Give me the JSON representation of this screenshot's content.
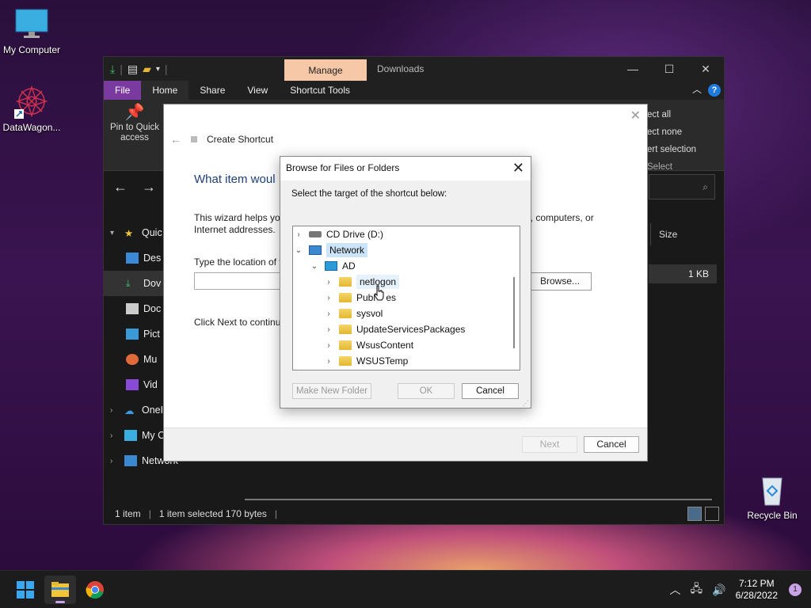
{
  "desktop": {
    "icons": [
      {
        "label": "My Computer"
      },
      {
        "label": "DataWagon..."
      },
      {
        "label": "Recycle Bin"
      }
    ]
  },
  "explorer": {
    "context_tab": "Manage",
    "title": "Downloads",
    "ribbon_tabs": [
      "File",
      "Home",
      "Share",
      "View",
      "Shortcut Tools"
    ],
    "pin_label": "Pin to Quick access",
    "selection_items": [
      "ect all",
      "ect none",
      "ert selection"
    ],
    "selection_group": "Select",
    "column_size": "Size",
    "file_size": "1 KB",
    "sidebar": [
      {
        "label": "Quic",
        "level": 0,
        "expanded": true
      },
      {
        "label": "Des",
        "level": 1
      },
      {
        "label": "Dov",
        "level": 1,
        "selected": true
      },
      {
        "label": "Doc",
        "level": 1
      },
      {
        "label": "Pict",
        "level": 1
      },
      {
        "label": "Mu",
        "level": 1
      },
      {
        "label": "Vid",
        "level": 1
      },
      {
        "label": "OneI",
        "level": 0
      },
      {
        "label": "My C",
        "level": 0
      },
      {
        "label": "Network",
        "level": 0
      }
    ],
    "status": {
      "items": "1 item",
      "selected": "1 item selected  170 bytes"
    }
  },
  "wizard": {
    "title": "Create Shortcut",
    "question": "What item woul",
    "desc_left": "This wizard helps you",
    "desc_left2": "Internet addresses.",
    "desc_right": "ers, computers, or",
    "location_label": "Type the location of t",
    "browse": "Browse...",
    "next_hint": "Click Next to continu",
    "next": "Next",
    "cancel": "Cancel"
  },
  "browse_dialog": {
    "title": "Browse for Files or Folders",
    "instruction": "Select the target of the shortcut below:",
    "tree": [
      {
        "label": "CD Drive (D:)",
        "icon": "drive-icon"
      },
      {
        "label": "Network",
        "icon": "network-icon",
        "highlighted": true
      },
      {
        "label": "AD",
        "icon": "computer-icon"
      },
      {
        "label": "netlogon",
        "icon": "folder-icon",
        "hover": true
      },
      {
        "label": "Publ    es",
        "icon": "folder-icon"
      },
      {
        "label": "sysvol",
        "icon": "folder-icon"
      },
      {
        "label": "UpdateServicesPackages",
        "icon": "folder-icon"
      },
      {
        "label": "WsusContent",
        "icon": "folder-icon"
      },
      {
        "label": "WSUSTemp",
        "icon": "folder-icon"
      }
    ],
    "make_new_folder": "Make New Folder",
    "ok": "OK",
    "cancel": "Cancel"
  },
  "taskbar": {
    "time": "7:12 PM",
    "date": "6/28/2022",
    "notifications": "1"
  },
  "colors": {
    "file_tab": "#7a3aa0",
    "manage_tab": "#f7c8a8",
    "selection_highlight": "#cce4f7",
    "help_icon": "#1f7ae0"
  }
}
